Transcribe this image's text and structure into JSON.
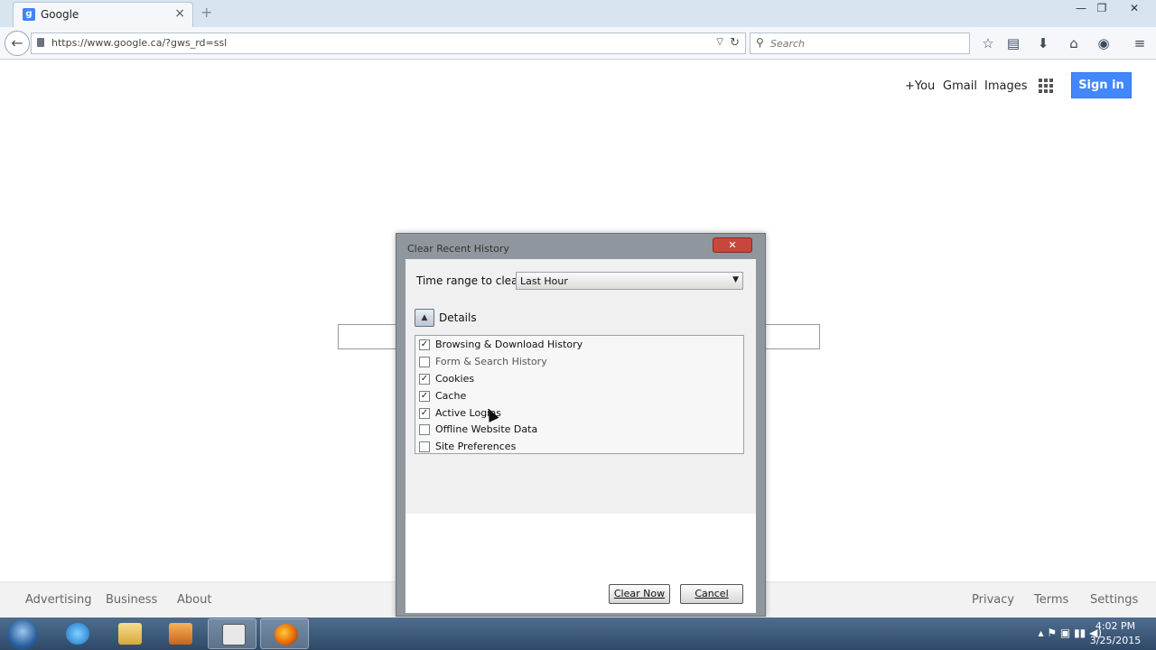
{
  "browser": {
    "tab_title": "Google",
    "new_tab_symbol": "+",
    "url": "https://www.google.ca/?gws_rd=ssl",
    "search_placeholder": "Search",
    "window_controls": {
      "minimize": "—",
      "restore": "❐",
      "close": "✕"
    }
  },
  "page": {
    "top_links": [
      "+You",
      "Gmail",
      "Images"
    ],
    "sign_in_label": "Sign in",
    "footer_left": [
      "Advertising",
      "Business",
      "About"
    ],
    "footer_right": [
      "Privacy",
      "Terms",
      "Settings"
    ]
  },
  "dialog": {
    "title": "Clear Recent History",
    "time_range_label": "Time range to clear:",
    "time_range_value": "Last Hour",
    "details_label": "Details",
    "items": [
      {
        "label": "Browsing & Download History",
        "checked": true
      },
      {
        "label": "Form & Search History",
        "checked": false
      },
      {
        "label": "Cookies",
        "checked": true
      },
      {
        "label": "Cache",
        "checked": true
      },
      {
        "label": "Active Logins",
        "checked": true
      },
      {
        "label": "Offline Website Data",
        "checked": false
      },
      {
        "label": "Site Preferences",
        "checked": false
      }
    ],
    "clear_now_label": "Clear Now",
    "cancel_label": "Cancel"
  },
  "taskbar": {
    "clock_time": "4:02 PM",
    "clock_date": "3/25/2015"
  }
}
